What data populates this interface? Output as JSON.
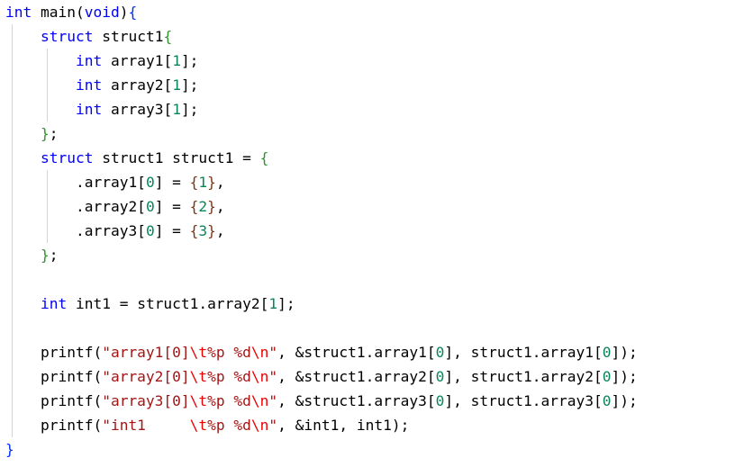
{
  "code_lines": [
    [
      {
        "t": "int",
        "c": "kw"
      },
      {
        "t": " main(",
        "c": "txt"
      },
      {
        "t": "void",
        "c": "kw"
      },
      {
        "t": ")",
        "c": "txt"
      },
      {
        "t": "{",
        "c": "brace1"
      }
    ],
    [
      {
        "t": "    ",
        "c": "txt"
      },
      {
        "t": "struct",
        "c": "kw"
      },
      {
        "t": " struct1",
        "c": "txt"
      },
      {
        "t": "{",
        "c": "brace2"
      }
    ],
    [
      {
        "t": "        ",
        "c": "txt"
      },
      {
        "t": "int",
        "c": "kw"
      },
      {
        "t": " array1[",
        "c": "txt"
      },
      {
        "t": "1",
        "c": "num"
      },
      {
        "t": "];",
        "c": "txt"
      }
    ],
    [
      {
        "t": "        ",
        "c": "txt"
      },
      {
        "t": "int",
        "c": "kw"
      },
      {
        "t": " array2[",
        "c": "txt"
      },
      {
        "t": "1",
        "c": "num"
      },
      {
        "t": "];",
        "c": "txt"
      }
    ],
    [
      {
        "t": "        ",
        "c": "txt"
      },
      {
        "t": "int",
        "c": "kw"
      },
      {
        "t": " array3[",
        "c": "txt"
      },
      {
        "t": "1",
        "c": "num"
      },
      {
        "t": "];",
        "c": "txt"
      }
    ],
    [
      {
        "t": "    ",
        "c": "txt"
      },
      {
        "t": "}",
        "c": "brace2"
      },
      {
        "t": ";",
        "c": "txt"
      }
    ],
    [
      {
        "t": "    ",
        "c": "txt"
      },
      {
        "t": "struct",
        "c": "kw"
      },
      {
        "t": " struct1 struct1 = ",
        "c": "txt"
      },
      {
        "t": "{",
        "c": "brace2"
      }
    ],
    [
      {
        "t": "        .array1[",
        "c": "txt"
      },
      {
        "t": "0",
        "c": "num"
      },
      {
        "t": "] = ",
        "c": "txt"
      },
      {
        "t": "{",
        "c": "brace3"
      },
      {
        "t": "1",
        "c": "num"
      },
      {
        "t": "}",
        "c": "brace3"
      },
      {
        "t": ",",
        "c": "txt"
      }
    ],
    [
      {
        "t": "        .array2[",
        "c": "txt"
      },
      {
        "t": "0",
        "c": "num"
      },
      {
        "t": "] = ",
        "c": "txt"
      },
      {
        "t": "{",
        "c": "brace3"
      },
      {
        "t": "2",
        "c": "num"
      },
      {
        "t": "}",
        "c": "brace3"
      },
      {
        "t": ",",
        "c": "txt"
      }
    ],
    [
      {
        "t": "        .array3[",
        "c": "txt"
      },
      {
        "t": "0",
        "c": "num"
      },
      {
        "t": "] = ",
        "c": "txt"
      },
      {
        "t": "{",
        "c": "brace3"
      },
      {
        "t": "3",
        "c": "num"
      },
      {
        "t": "}",
        "c": "brace3"
      },
      {
        "t": ",",
        "c": "txt"
      }
    ],
    [
      {
        "t": "    ",
        "c": "txt"
      },
      {
        "t": "}",
        "c": "brace2"
      },
      {
        "t": ";",
        "c": "txt"
      }
    ],
    [],
    [
      {
        "t": "    ",
        "c": "txt"
      },
      {
        "t": "int",
        "c": "kw"
      },
      {
        "t": " int1 = struct1.array2[",
        "c": "txt"
      },
      {
        "t": "1",
        "c": "num"
      },
      {
        "t": "];",
        "c": "txt"
      }
    ],
    [],
    [
      {
        "t": "    printf(",
        "c": "txt"
      },
      {
        "t": "\"array1[0]",
        "c": "str"
      },
      {
        "t": "\\t",
        "c": "esc"
      },
      {
        "t": "%p %d",
        "c": "str"
      },
      {
        "t": "\\n",
        "c": "esc"
      },
      {
        "t": "\"",
        "c": "str"
      },
      {
        "t": ", &struct1.array1[",
        "c": "txt"
      },
      {
        "t": "0",
        "c": "num"
      },
      {
        "t": "], struct1.array1[",
        "c": "txt"
      },
      {
        "t": "0",
        "c": "num"
      },
      {
        "t": "]);",
        "c": "txt"
      }
    ],
    [
      {
        "t": "    printf(",
        "c": "txt"
      },
      {
        "t": "\"array2[0]",
        "c": "str"
      },
      {
        "t": "\\t",
        "c": "esc"
      },
      {
        "t": "%p %d",
        "c": "str"
      },
      {
        "t": "\\n",
        "c": "esc"
      },
      {
        "t": "\"",
        "c": "str"
      },
      {
        "t": ", &struct1.array2[",
        "c": "txt"
      },
      {
        "t": "0",
        "c": "num"
      },
      {
        "t": "], struct1.array2[",
        "c": "txt"
      },
      {
        "t": "0",
        "c": "num"
      },
      {
        "t": "]);",
        "c": "txt"
      }
    ],
    [
      {
        "t": "    printf(",
        "c": "txt"
      },
      {
        "t": "\"array3[0]",
        "c": "str"
      },
      {
        "t": "\\t",
        "c": "esc"
      },
      {
        "t": "%p %d",
        "c": "str"
      },
      {
        "t": "\\n",
        "c": "esc"
      },
      {
        "t": "\"",
        "c": "str"
      },
      {
        "t": ", &struct1.array3[",
        "c": "txt"
      },
      {
        "t": "0",
        "c": "num"
      },
      {
        "t": "], struct1.array3[",
        "c": "txt"
      },
      {
        "t": "0",
        "c": "num"
      },
      {
        "t": "]);",
        "c": "txt"
      }
    ],
    [
      {
        "t": "    printf(",
        "c": "txt"
      },
      {
        "t": "\"int1     ",
        "c": "str"
      },
      {
        "t": "\\t",
        "c": "esc"
      },
      {
        "t": "%p %d",
        "c": "str"
      },
      {
        "t": "\\n",
        "c": "esc"
      },
      {
        "t": "\"",
        "c": "str"
      },
      {
        "t": ", &int1, int1);",
        "c": "txt"
      }
    ],
    [
      {
        "t": "}",
        "c": "brace1"
      }
    ]
  ],
  "colors": {
    "keyword": "#0000ff",
    "number": "#098658",
    "string": "#a31515",
    "escape": "#ee0000",
    "brace_level1": "#0431fa",
    "brace_level2": "#319331",
    "brace_level3": "#7b3814",
    "text": "#000000",
    "indent_guide": "#d4d4d4"
  }
}
